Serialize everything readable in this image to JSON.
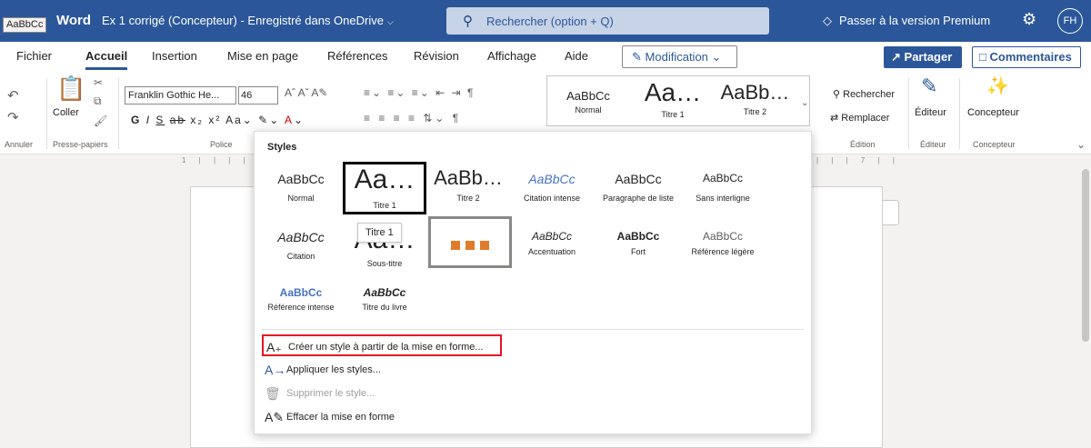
{
  "titlebar": {
    "tooltip": "AaBbCc",
    "app_name": "Word",
    "doc_title": "Ex 1 corrigé (Concepteur) - Enregistré dans OneDrive",
    "search_placeholder": "Rechercher (option + Q)",
    "premium": "Passer à la version Premium",
    "avatar": "FH"
  },
  "tabs": [
    "Fichier",
    "Accueil",
    "Insertion",
    "Mise en page",
    "Références",
    "Révision",
    "Affichage",
    "Aide"
  ],
  "active_tab": "Accueil",
  "editing_mode": "Modification",
  "share_label": "Partager",
  "comments_label": "Commentaires",
  "ribbon": {
    "paste_label": "Coller",
    "font_name": "Franklin Gothic He...",
    "font_size": "46",
    "groups": {
      "undo": "Annuler",
      "clipboard": "Presse-papiers",
      "font": "Police",
      "editing": "Édition",
      "editor": "Éditeur",
      "designer": "Concepteur"
    },
    "gallery": [
      {
        "sample": "AaBbCc",
        "label": "Normal"
      },
      {
        "sample": "Aa…",
        "label": "Titre 1"
      },
      {
        "sample": "AaBb…",
        "label": "Titre 2"
      }
    ],
    "find_label": "Rechercher",
    "replace_label": "Remplacer",
    "editor_label": "Éditeur",
    "designer_label": "Concepteur"
  },
  "ruler_marks": "1 | | | |",
  "ruler_marks_right": "| | | 7 | |",
  "styles_panel": {
    "title": "Styles",
    "hover_tooltip": "Titre 1",
    "styles": [
      {
        "sample": "AaBbCc",
        "label": "Normal"
      },
      {
        "sample": "Aa…",
        "label": "Titre 1"
      },
      {
        "sample": "AaBb…",
        "label": "Titre 2"
      },
      {
        "sample": "AaBbCc",
        "label": "Citation intense"
      },
      {
        "sample": "AaBbCc",
        "label": "Paragraphe de liste"
      },
      {
        "sample": "AaBbCc",
        "label": "Sans interligne"
      },
      {
        "sample": "AaBbCc",
        "label": "Citation"
      },
      {
        "sample": "Aa…",
        "label": "Sous-titre"
      },
      {
        "sample": "",
        "label": ""
      },
      {
        "sample": "AaBbCc",
        "label": "Accentuation"
      },
      {
        "sample": "AaBbCc",
        "label": "Fort"
      },
      {
        "sample": "AaBbCc",
        "label": "Référence légère"
      },
      {
        "sample": "AaBbCc",
        "label": "Référence intense"
      },
      {
        "sample": "AaBbCc",
        "label": "Titre du livre"
      }
    ],
    "menu": {
      "create": "Créer un style à partir de la mise en forme...",
      "apply": "Appliquer les styles...",
      "delete": "Supprimer le style...",
      "clear": "Effacer la mise en forme"
    }
  },
  "colors": {
    "brand": "#2b579a",
    "highlight_border": "#e81123",
    "accent_orange": "#e07b2a"
  }
}
